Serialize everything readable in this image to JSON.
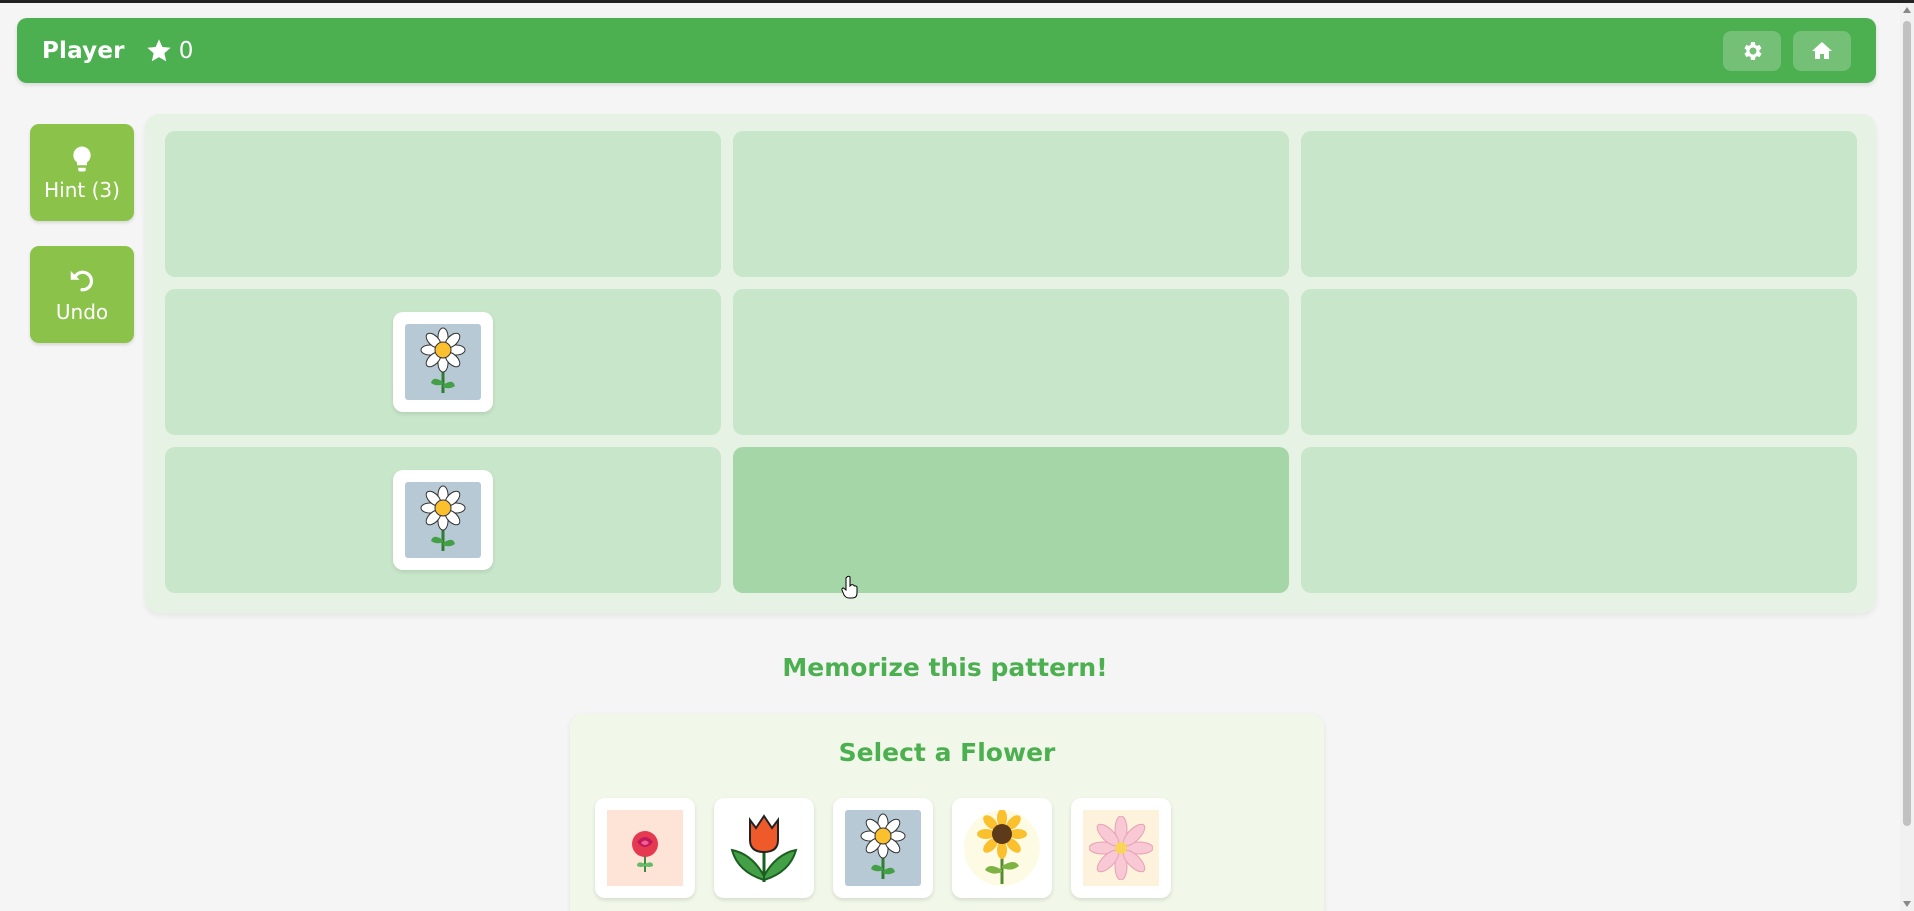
{
  "header": {
    "player_name": "Player",
    "score": "0",
    "icons": [
      "star-icon",
      "gear-icon",
      "home-icon"
    ]
  },
  "sidebar": {
    "hint_label": "Hint (3)",
    "undo_label": "Undo"
  },
  "board": {
    "rows": 3,
    "cols": 3,
    "cells": [
      [
        null,
        null,
        null
      ],
      [
        "daisy",
        null,
        null
      ],
      [
        "daisy",
        null,
        null
      ]
    ],
    "hovered_cell": [
      2,
      1
    ]
  },
  "status_message": "Memorize this pattern!",
  "selector": {
    "title": "Select a Flower",
    "options": [
      "rose",
      "tulip",
      "daisy",
      "sunflower",
      "lotus"
    ]
  },
  "colors": {
    "primary": "#4caf50",
    "side_button": "#8bc34a",
    "cell": "#c8e6c9",
    "cell_hover": "#a5d6a7",
    "board_bg": "#e6f2e4"
  }
}
